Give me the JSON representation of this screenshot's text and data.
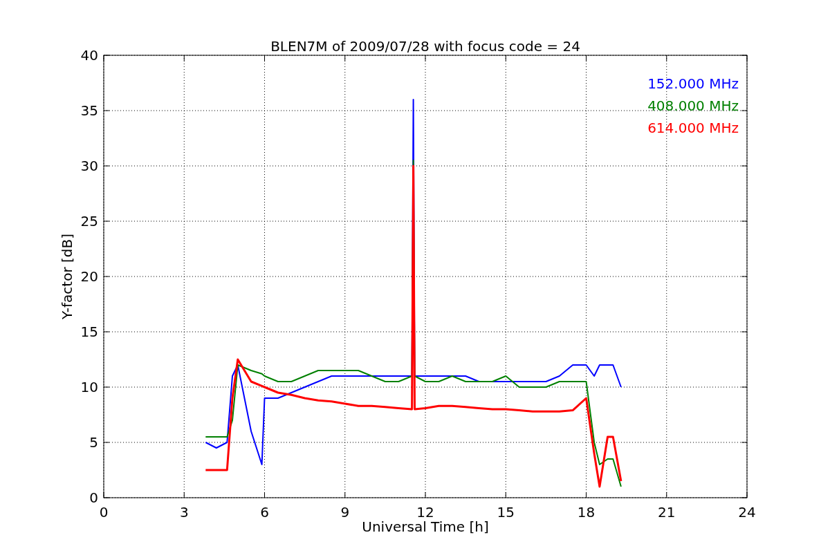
{
  "chart_data": {
    "type": "line",
    "title": "BLEN7M of 2009/07/28 with focus code = 24",
    "xlabel": "Universal Time [h]",
    "ylabel": "Y-factor [dB]",
    "x": [
      3.8,
      4.2,
      4.6,
      4.8,
      5.0,
      5.5,
      5.9,
      6.0,
      6.5,
      7,
      7.5,
      8,
      8.5,
      9,
      9.5,
      10,
      10.5,
      11,
      11.5,
      11.55,
      11.6,
      12,
      12.5,
      13,
      13.5,
      14,
      14.5,
      15,
      15.5,
      16,
      16.5,
      17,
      17.5,
      18,
      18.3,
      18.5,
      18.8,
      19,
      19.3
    ],
    "series": [
      {
        "name": "152.000 MHz",
        "color": "#0000ff",
        "values": [
          5,
          4.5,
          5,
          11,
          12,
          6,
          3,
          9,
          9,
          9.5,
          10,
          10.5,
          11,
          11,
          11,
          11,
          11,
          11,
          11,
          36,
          11,
          11,
          11,
          11,
          11,
          10.5,
          10.5,
          10.5,
          10.5,
          10.5,
          10.5,
          11,
          12,
          12,
          11,
          12,
          12,
          12,
          10
        ]
      },
      {
        "name": "408.000 MHz",
        "color": "#008000",
        "values": [
          5.5,
          5.5,
          5.5,
          7,
          12,
          11.5,
          11.2,
          11,
          10.5,
          10.5,
          11,
          11.5,
          11.5,
          11.5,
          11.5,
          11,
          10.5,
          10.5,
          11,
          30.5,
          11,
          10.5,
          10.5,
          11,
          10.5,
          10.5,
          10.5,
          11,
          10,
          10,
          10,
          10.5,
          10.5,
          10.5,
          5,
          3,
          3.5,
          3.5,
          1
        ]
      },
      {
        "name": "614.000 MHz",
        "color": "#ff0000",
        "values": [
          2.5,
          2.5,
          2.5,
          9,
          12.5,
          10.5,
          10.1,
          10,
          9.5,
          9.3,
          9,
          8.8,
          8.7,
          8.5,
          8.3,
          8.3,
          8.2,
          8.1,
          8,
          30,
          8,
          8.1,
          8.3,
          8.3,
          8.2,
          8.1,
          8,
          8,
          7.9,
          7.8,
          7.8,
          7.8,
          7.9,
          9,
          4,
          1,
          5.5,
          5.5,
          1.5
        ]
      }
    ],
    "grid": true,
    "xlim": [
      0,
      24
    ],
    "ylim": [
      0,
      40
    ],
    "xticks": [
      0,
      3,
      6,
      9,
      12,
      15,
      18,
      21,
      24
    ],
    "yticks": [
      0,
      5,
      10,
      15,
      20,
      25,
      30,
      35,
      40
    ]
  }
}
